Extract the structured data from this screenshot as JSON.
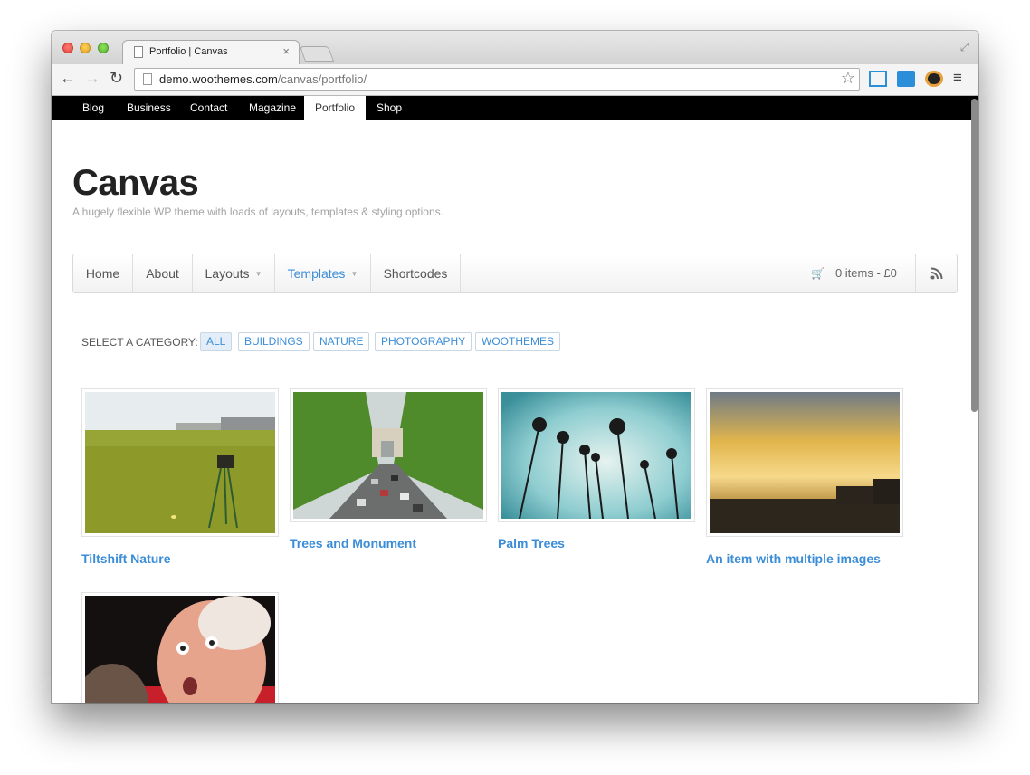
{
  "browser": {
    "tab_title": "Portfolio | Canvas",
    "tab_close": "×",
    "url_host": "demo.woothemes.com",
    "url_path": "/canvas/portfolio/"
  },
  "topbar": {
    "links": [
      "Blog",
      "Business",
      "Contact",
      "Magazine",
      "Portfolio",
      "Shop"
    ]
  },
  "site": {
    "title": "Canvas",
    "description": "A hugely flexible WP theme with loads of layouts, templates & styling options."
  },
  "mainnav": {
    "items": [
      "Home",
      "About",
      "Layouts",
      "Templates",
      "Shortcodes"
    ],
    "cart": "0 items - £0"
  },
  "categories": {
    "label": "SELECT A CATEGORY:",
    "items": [
      "ALL",
      "BUILDINGS",
      "NATURE",
      "PHOTOGRAPHY",
      "WOOTHEMES"
    ]
  },
  "portfolio": [
    {
      "title": "Tiltshift Nature",
      "image": "golf-field-image"
    },
    {
      "title": "Trees and Monument",
      "image": "arc-de-triomphe-image"
    },
    {
      "title": "Palm Trees",
      "image": "palm-trees-image"
    },
    {
      "title": "An item with multiple images",
      "image": "sunset-image"
    },
    {
      "title": "",
      "image": "surprised-man-image"
    }
  ],
  "colors": {
    "accent": "#3b8dd8",
    "topbar_bg": "#000000",
    "title": "#222222"
  }
}
